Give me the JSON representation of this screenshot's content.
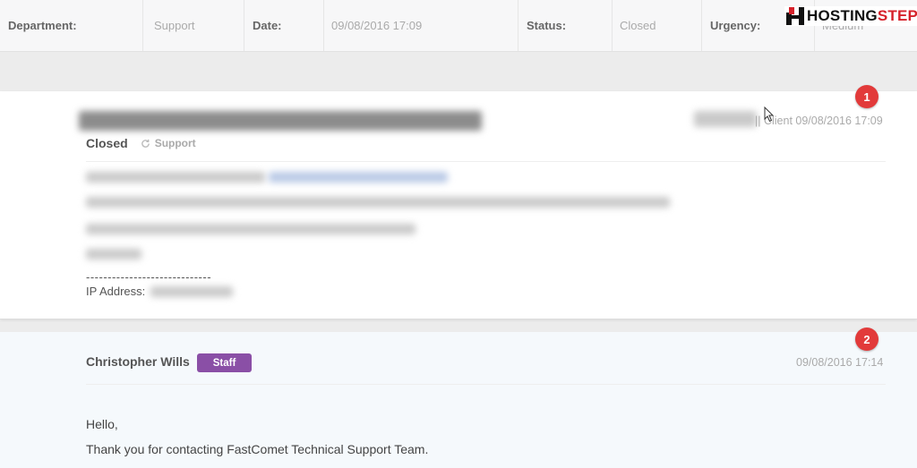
{
  "header": {
    "department_label": "Department:",
    "department_value": "Support",
    "date_label": "Date:",
    "date_value": "09/08/2016 17:09",
    "status_label": "Status:",
    "status_value": "Closed",
    "urgency_label": "Urgency:",
    "urgency_value": "Medium"
  },
  "logo": {
    "part1": "HOSTING",
    "part2": "STEP"
  },
  "message1": {
    "meta": "|| Client 09/08/2016 17:09",
    "status": "Closed",
    "department": "Support",
    "signature_dashes": "-----------------------------",
    "ip_label": "IP Address:",
    "annotation": "1"
  },
  "message2": {
    "author": "Christopher Wills",
    "role_badge": "Staff",
    "date": "09/08/2016 17:14",
    "greeting": "Hello,",
    "line1": "Thank you for contacting FastComet Technical Support Team.",
    "annotation": "2"
  },
  "colors": {
    "staff_badge": "#8a4fa6",
    "annotation_badge": "#e23a3a",
    "logo_red": "#d6212a"
  }
}
